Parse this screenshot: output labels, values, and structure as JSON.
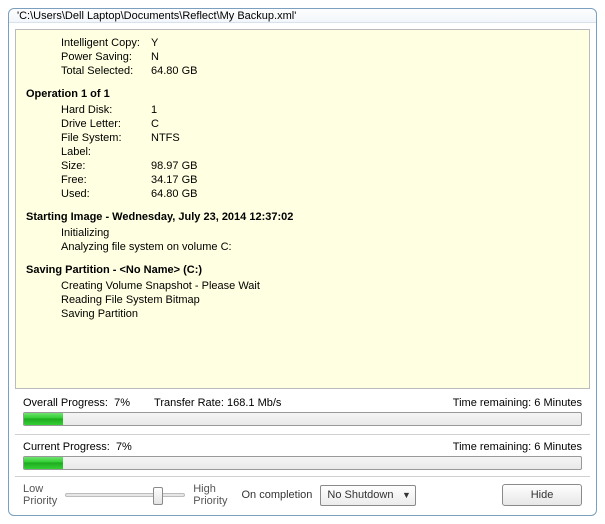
{
  "window": {
    "title": "'C:\\Users\\Dell Laptop\\Documents\\Reflect\\My Backup.xml'"
  },
  "log": {
    "top_rows": [
      {
        "key": "Intelligent Copy:",
        "val": "Y"
      },
      {
        "key": "Power Saving:",
        "val": "N"
      },
      {
        "key": "Total Selected:",
        "val": "64.80 GB"
      }
    ],
    "operation_head": "Operation 1 of 1",
    "operation_rows": [
      {
        "key": "Hard Disk:",
        "val": "1"
      },
      {
        "key": "Drive Letter:",
        "val": "C"
      },
      {
        "key": "File System:",
        "val": "NTFS"
      },
      {
        "key": "Label:",
        "val": ""
      },
      {
        "key": "Size:",
        "val": "98.97 GB"
      },
      {
        "key": "Free:",
        "val": "34.17 GB"
      },
      {
        "key": "Used:",
        "val": "64.80 GB"
      }
    ],
    "start_head": "Starting Image - Wednesday, July 23, 2014 12:37:02",
    "start_lines": [
      "Initializing",
      "Analyzing file system on volume C:"
    ],
    "saving_head": "Saving Partition - <No Name> (C:)",
    "saving_lines": [
      "Creating Volume Snapshot - Please Wait",
      "Reading File System Bitmap",
      "Saving Partition"
    ]
  },
  "progress": {
    "overall_label": "Overall Progress:",
    "overall_pct": "7%",
    "transfer_label": "Transfer Rate:",
    "transfer_rate": "168.1 Mb/s",
    "overall_time_label": "Time remaining:",
    "overall_time": "6 Minutes",
    "current_label": "Current Progress:",
    "current_pct": "7%",
    "current_time_label": "Time remaining:",
    "current_time": "6 Minutes",
    "fill_pct": 7
  },
  "footer": {
    "low_label": "Low\nPriority",
    "high_label": "High\nPriority",
    "on_completion_label": "On completion",
    "on_completion_value": "No Shutdown",
    "hide_label": "Hide",
    "slider_pos_pct": 78
  }
}
